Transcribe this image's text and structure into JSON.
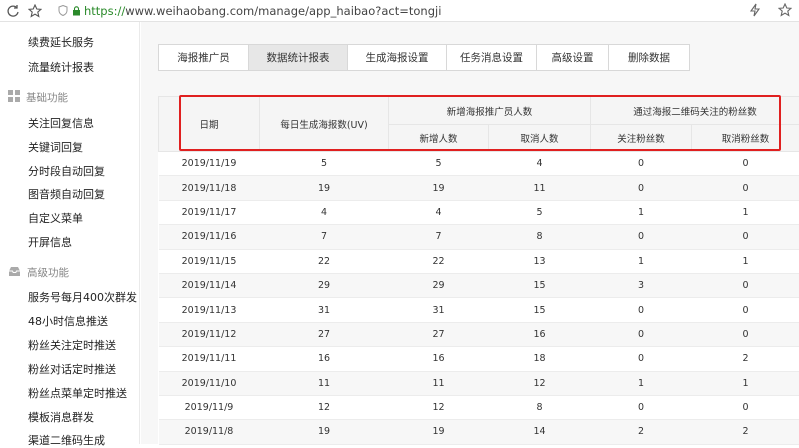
{
  "browser": {
    "url_scheme": "https://",
    "url_rest": "www.weihaobang.com/manage/app_haibao?act=tongji"
  },
  "sidebar": {
    "top_items": [
      "续费延长服务",
      "流量统计报表"
    ],
    "sections": [
      {
        "title": "基础功能",
        "icon": "grid-icon",
        "items": [
          "关注回复信息",
          "关键词回复",
          "分时段自动回复",
          "图音频自动回复",
          "自定义菜单",
          "开屏信息"
        ]
      },
      {
        "title": "高级功能",
        "icon": "inbox-icon",
        "items": [
          "服务号每月400次群发",
          "48小时信息推送",
          "粉丝关注定时推送",
          "粉丝对话定时推送",
          "粉丝点菜单定时推送",
          "模板消息群发",
          "渠道二维码生成"
        ]
      }
    ]
  },
  "tabs": [
    {
      "label": "海报推广员",
      "active": false
    },
    {
      "label": "数据统计报表",
      "active": true
    },
    {
      "label": "生成海报设置",
      "active": false
    },
    {
      "label": "任务消息设置",
      "active": false
    },
    {
      "label": "高级设置",
      "active": false
    },
    {
      "label": "删除数据",
      "active": false
    }
  ],
  "table": {
    "head": {
      "date": "日期",
      "daily_posters": "每日生成海报数(UV)",
      "group_new_promoters": "新增海报推广员人数",
      "group_qr_fans": "通过海报二维码关注的粉丝数",
      "new_count": "新增人数",
      "cancel_count": "取消人数",
      "follow_fans": "关注粉丝数",
      "cancel_fans": "取消粉丝数"
    },
    "rows": [
      [
        "2019/11/19",
        "5",
        "5",
        "4",
        "0",
        "0"
      ],
      [
        "2019/11/18",
        "19",
        "19",
        "11",
        "0",
        "0"
      ],
      [
        "2019/11/17",
        "4",
        "4",
        "5",
        "1",
        "1"
      ],
      [
        "2019/11/16",
        "7",
        "7",
        "8",
        "0",
        "0"
      ],
      [
        "2019/11/15",
        "22",
        "22",
        "13",
        "1",
        "1"
      ],
      [
        "2019/11/14",
        "29",
        "29",
        "15",
        "3",
        "0"
      ],
      [
        "2019/11/13",
        "31",
        "31",
        "15",
        "0",
        "0"
      ],
      [
        "2019/11/12",
        "27",
        "27",
        "16",
        "0",
        "0"
      ],
      [
        "2019/11/11",
        "16",
        "16",
        "18",
        "0",
        "2"
      ],
      [
        "2019/11/10",
        "11",
        "11",
        "12",
        "1",
        "1"
      ],
      [
        "2019/11/9",
        "12",
        "12",
        "8",
        "0",
        "0"
      ],
      [
        "2019/11/8",
        "19",
        "19",
        "14",
        "2",
        "2"
      ]
    ]
  },
  "colors": {
    "highlight": "#e02020",
    "https": "#2a8a2a"
  }
}
